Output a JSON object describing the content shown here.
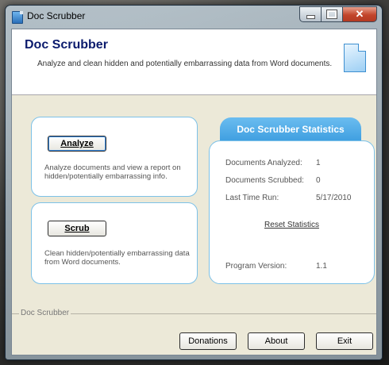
{
  "window": {
    "title": "Doc Scrubber"
  },
  "header": {
    "title": "Doc Scrubber",
    "subtitle": "Analyze and clean hidden and potentially embarrassing data from Word documents."
  },
  "analyze": {
    "button_label": "Analyze",
    "description": "Analyze documents and view a report on hidden/potentially embarrassing info."
  },
  "scrub": {
    "button_label": "Scrub",
    "description": "Clean hidden/potentially embarrassing data from Word documents."
  },
  "stats": {
    "title": "Doc Scrubber Statistics",
    "rows": [
      {
        "label": "Documents Analyzed:",
        "value": "1"
      },
      {
        "label": "Documents Scrubbed:",
        "value": "0"
      },
      {
        "label": "Last Time Run:",
        "value": "5/17/2010"
      }
    ],
    "reset_label": "Reset Statistics",
    "version_label": "Program Version:",
    "version_value": "1.1"
  },
  "footer": {
    "group_label": "Doc Scrubber",
    "donations_label": "Donations",
    "about_label": "About",
    "exit_label": "Exit"
  }
}
